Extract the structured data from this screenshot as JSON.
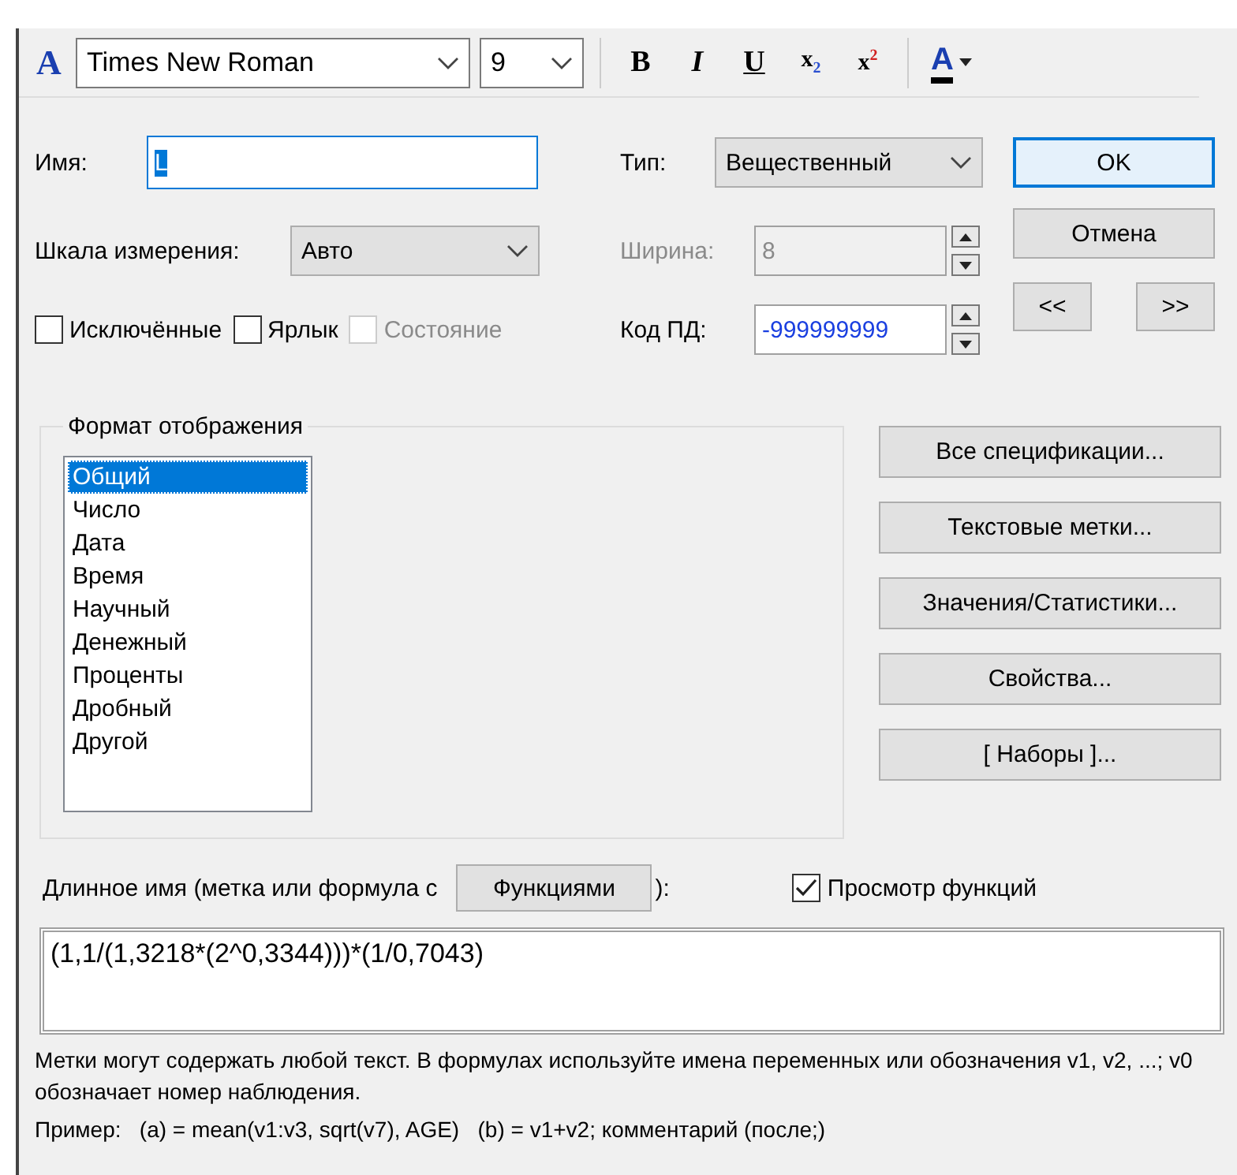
{
  "toolbar": {
    "font_icon": "A",
    "font": "Times New Roman",
    "size": "9",
    "buttons": [
      {
        "label": "B",
        "kind": "bold"
      },
      {
        "label": "I",
        "kind": "italic"
      },
      {
        "label": "U",
        "kind": "underline"
      },
      {
        "label": "x$_{2}$",
        "kind": "subscript"
      },
      {
        "label": "x$^{2}$",
        "kind": "superscript"
      }
    ],
    "color_button": "A"
  },
  "name": {
    "label": "Имя:",
    "value": "L"
  },
  "type": {
    "label": "Тип:",
    "value": "Вещественный"
  },
  "scale": {
    "label": "Шкала измерения:",
    "value": "Авто"
  },
  "width": {
    "label": "Ширина:",
    "value": "8",
    "disabled": true
  },
  "checkboxes": [
    {
      "label": "Исключённые",
      "checked": false,
      "disabled": false
    },
    {
      "label": "Ярлык",
      "checked": false,
      "disabled": false
    },
    {
      "label": "Состояние",
      "checked": false,
      "disabled": true
    }
  ],
  "missing_code": {
    "label": "Код ПД:",
    "value": "-999999999"
  },
  "dialog_buttons": [
    {
      "label": "OK",
      "default": true
    },
    {
      "label": "Отмена",
      "default": false
    }
  ],
  "nav_buttons": [
    "<<",
    ">>"
  ],
  "format": {
    "title": "Формат отображения",
    "items": [
      {
        "label": "Общий",
        "selected": true
      },
      {
        "label": "Число",
        "selected": false
      },
      {
        "label": "Дата",
        "selected": false
      },
      {
        "label": "Время",
        "selected": false
      },
      {
        "label": "Научный",
        "selected": false
      },
      {
        "label": "Денежный",
        "selected": false
      },
      {
        "label": "Проценты",
        "selected": false
      },
      {
        "label": "Дробный",
        "selected": false
      },
      {
        "label": "Другой",
        "selected": false
      }
    ]
  },
  "side_buttons": [
    "Все спецификации...",
    "Текстовые метки...",
    "Значения/Статистики...",
    "Свойства...",
    "[ Наборы ]..."
  ],
  "long_name": {
    "label": "Длинное имя (метка или формула с",
    "button": "Функциями",
    "label_end": "):",
    "preview": {
      "label": "Просмотр функций",
      "checked": true
    },
    "value": "(1,1/(1,3218*(2^0,3344)))*(1/0,7043)"
  },
  "help": "Метки могут содержать любой текст.  В формулах используйте имена переменных или обозначения v1, v2, ...; v0 обозначает номер наблюдения.",
  "example": "Пример:   (a) = mean(v1:v3, sqrt(v7), AGE)   (b) = v1+v2; комментарий (после;)"
}
